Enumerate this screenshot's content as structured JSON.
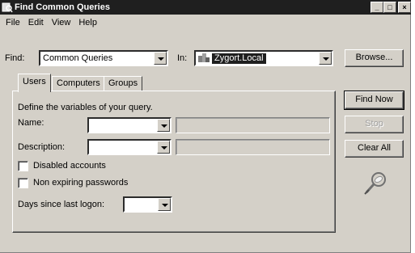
{
  "window": {
    "title": "Find Common Queries",
    "controls": {
      "minimize": "_",
      "maximize": "□",
      "close": "×"
    }
  },
  "menu": [
    "File",
    "Edit",
    "View",
    "Help"
  ],
  "find": {
    "label": "Find:",
    "value": "Common Queries"
  },
  "in": {
    "label": "In:",
    "value": "Zygort.Local"
  },
  "buttons": {
    "browse": "Browse...",
    "find_now": "Find Now",
    "stop": "Stop",
    "clear_all": "Clear All"
  },
  "tabs": [
    "Users",
    "Computers",
    "Groups"
  ],
  "users_tab": {
    "intro": "Define the variables of your query.",
    "name_label": "Name:",
    "description_label": "Description:",
    "disabled_accounts": "Disabled accounts",
    "non_expiring": "Non expiring passwords",
    "days_since_logon": "Days since last logon:"
  },
  "icons": {
    "app": "find-icon",
    "domain": "domain-icon",
    "search_animation": "magnifier-icon"
  },
  "colors": {
    "titlebar": "#1f1f1f",
    "face": "#d4d0c8",
    "selection": "#1f1f1f"
  }
}
